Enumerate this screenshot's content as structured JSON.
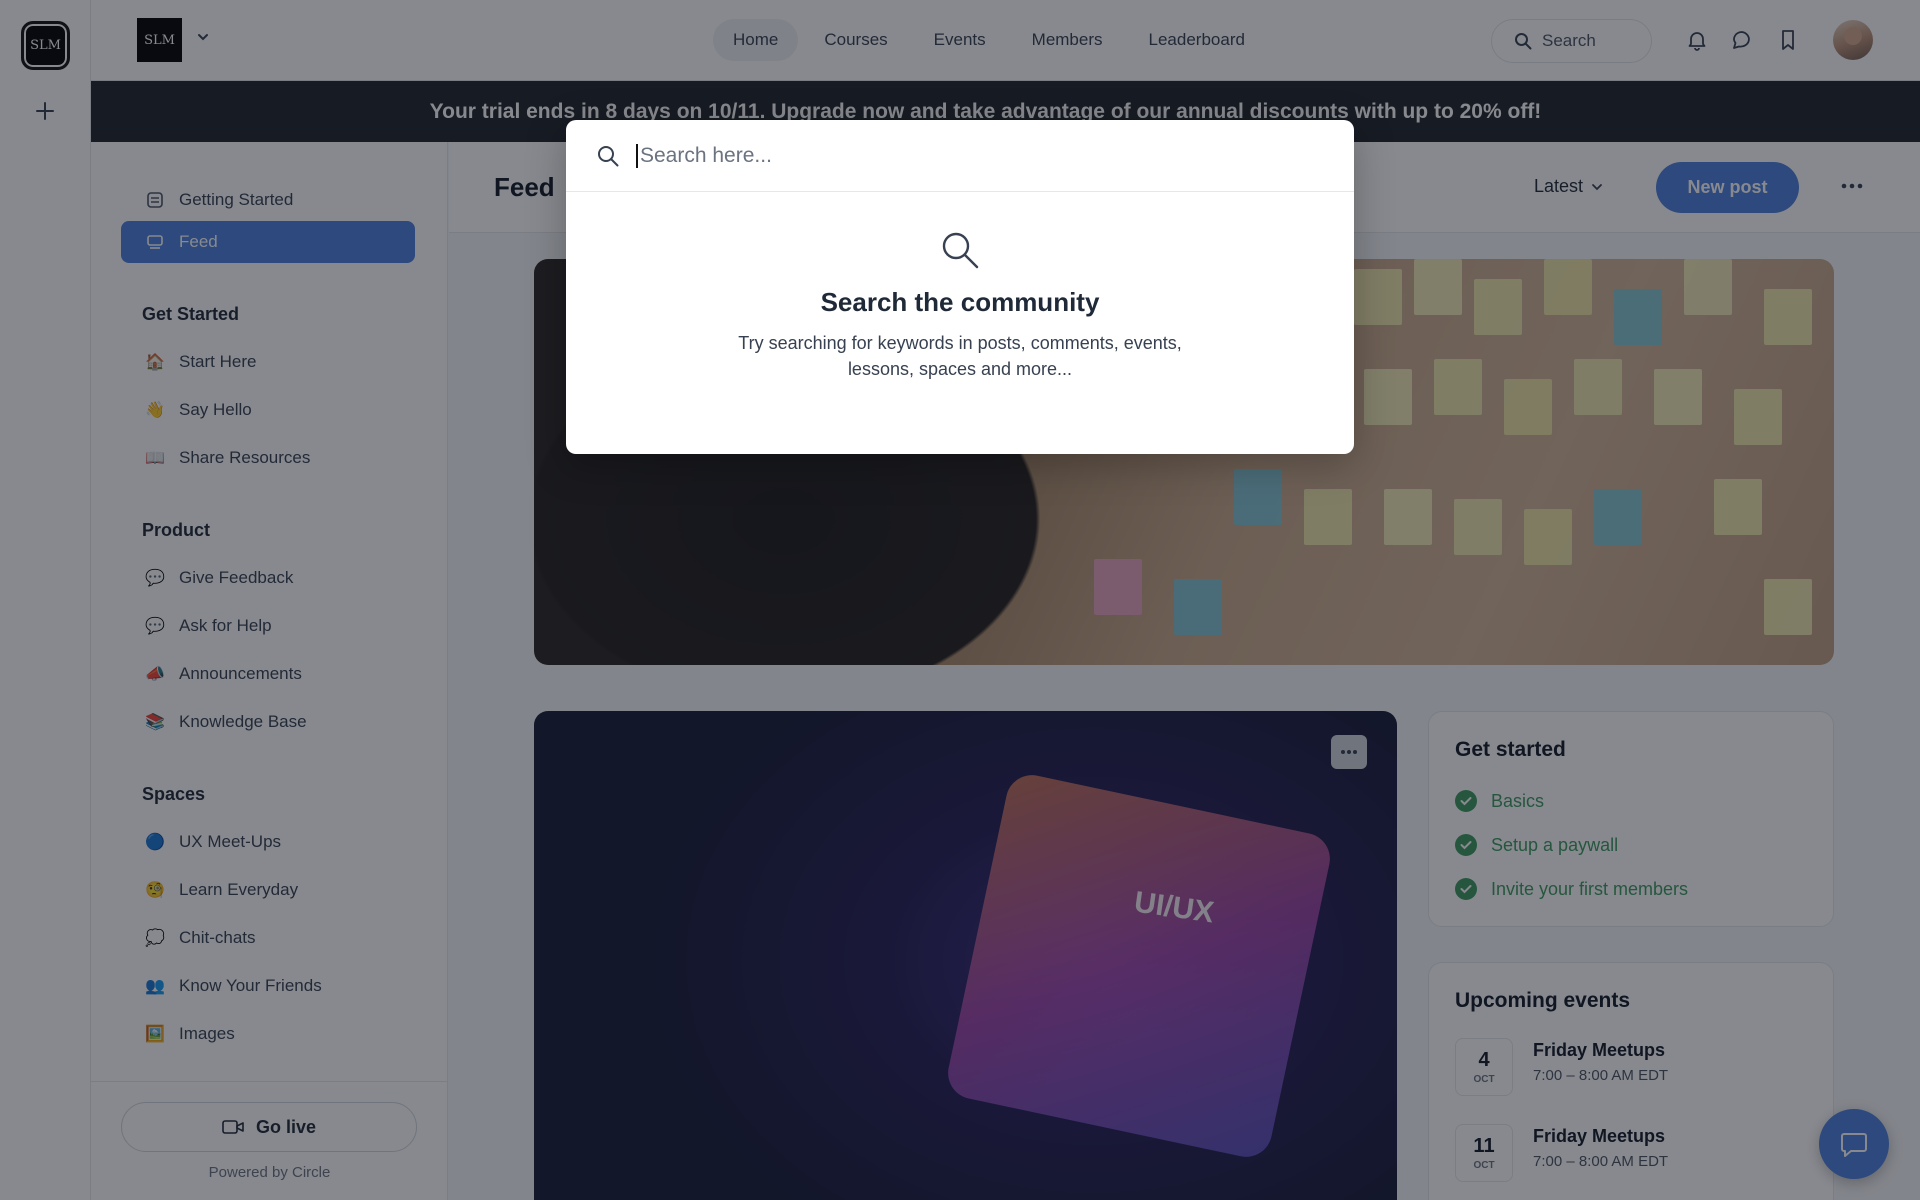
{
  "rail": {
    "logo_text": "SLM"
  },
  "header": {
    "brand_text": "SLM",
    "nav": [
      "Home",
      "Courses",
      "Events",
      "Members",
      "Leaderboard"
    ],
    "search_label": "Search"
  },
  "banner": {
    "text": "Your trial ends in 8 days on 10/11. Upgrade now and take advantage of our annual discounts with up to 20% off!"
  },
  "sidebar": {
    "top_items": [
      {
        "label": "Getting Started",
        "icon": "checklist-icon"
      },
      {
        "label": "Feed",
        "icon": "feed-icon",
        "active": true
      }
    ],
    "sections": [
      {
        "title": "Get Started",
        "items": [
          {
            "label": "Start Here",
            "emoji": "🏠"
          },
          {
            "label": "Say Hello",
            "emoji": "👋"
          },
          {
            "label": "Share Resources",
            "emoji": "📖"
          }
        ]
      },
      {
        "title": "Product",
        "items": [
          {
            "label": "Give Feedback",
            "emoji": "💬"
          },
          {
            "label": "Ask for Help",
            "emoji": "💬"
          },
          {
            "label": "Announcements",
            "emoji": "📣"
          },
          {
            "label": "Knowledge Base",
            "emoji": "📚"
          }
        ]
      },
      {
        "title": "Spaces",
        "items": [
          {
            "label": "UX Meet-Ups",
            "emoji": "🔵"
          },
          {
            "label": "Learn Everyday",
            "emoji": "🧐"
          },
          {
            "label": "Chit-chats",
            "emoji": "💭"
          },
          {
            "label": "Know Your Friends",
            "emoji": "👥"
          },
          {
            "label": "Images",
            "emoji": "🖼️"
          }
        ]
      }
    ],
    "go_live_label": "Go live",
    "powered_by": "Powered by Circle"
  },
  "main": {
    "title": "Feed",
    "sort_label": "Latest",
    "new_post_label": "New post",
    "cover_text": "UI/UX"
  },
  "get_started": {
    "title": "Get started",
    "items": [
      "Basics",
      "Setup a paywall",
      "Invite your first members"
    ]
  },
  "upcoming_events": {
    "title": "Upcoming events",
    "events": [
      {
        "day": "4",
        "month": "OCT",
        "name": "Friday Meetups",
        "time": "7:00 – 8:00 AM EDT"
      },
      {
        "day": "11",
        "month": "OCT",
        "name": "Friday Meetups",
        "time": "7:00 – 8:00 AM EDT"
      }
    ]
  },
  "search_modal": {
    "placeholder": "Search here...",
    "empty_title": "Search the community",
    "empty_desc": "Try searching for keywords in posts, comments, events, lessons, spaces and more..."
  },
  "colors": {
    "accent": "#4a7fdd",
    "success": "#3d9a5f",
    "banner_bg": "#1f2328"
  }
}
